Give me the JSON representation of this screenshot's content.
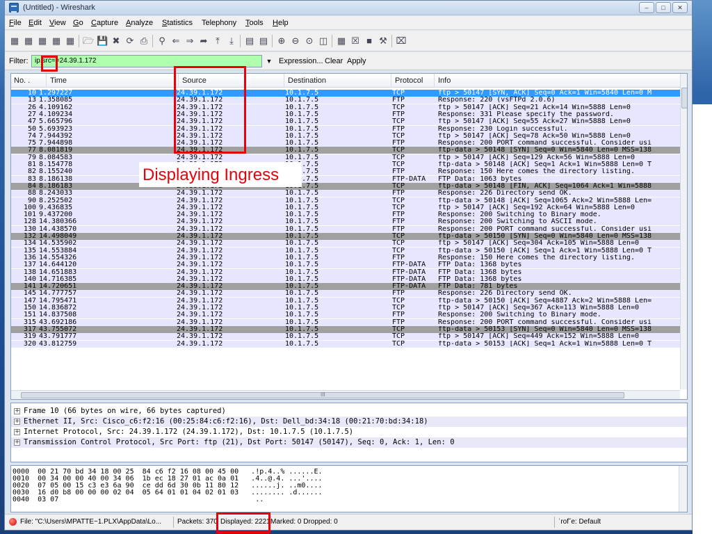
{
  "window": {
    "title": "(Untitled) - Wireshark"
  },
  "menu": [
    {
      "label": "File",
      "u": "F",
      "rest": "ile"
    },
    {
      "label": "Edit",
      "u": "E",
      "rest": "dit"
    },
    {
      "label": "View",
      "u": "V",
      "rest": "iew"
    },
    {
      "label": "Go",
      "u": "G",
      "rest": "o"
    },
    {
      "label": "Capture",
      "u": "C",
      "rest": "apture"
    },
    {
      "label": "Analyze",
      "u": "A",
      "rest": "nalyze"
    },
    {
      "label": "Statistics",
      "u": "S",
      "rest": "tatistics"
    },
    {
      "label": "Telephony",
      "u": "",
      "rest": "Telephony"
    },
    {
      "label": "Tools",
      "u": "T",
      "rest": "ools"
    },
    {
      "label": "Help",
      "u": "H",
      "rest": "elp"
    }
  ],
  "filter": {
    "label": "Filter:",
    "value": "ip.src==24.39.1.172",
    "expression": "Expression...",
    "clear": "Clear",
    "apply": "Apply"
  },
  "columns": [
    "No. .",
    "Time",
    "Source",
    "Destination",
    "Protocol",
    "Info"
  ],
  "packets": [
    {
      "no": "10",
      "time": "1.297227",
      "src": "24.39.1.172",
      "dst": "10.1.7.5",
      "proto": "TCP",
      "info": "ftp > 50147 [SYN, ACK] Seq=0 Ack=1 Win=5840 Len=0 M",
      "style": "sel"
    },
    {
      "no": "13",
      "time": "1.358085",
      "src": "24.39.1.172",
      "dst": "10.1.7.5",
      "proto": "FTP",
      "info": "Response: 220 (vsFTPd 2.0.6)",
      "style": "ftp"
    },
    {
      "no": "26",
      "time": "4.109162",
      "src": "24.39.1.172",
      "dst": "10.1.7.5",
      "proto": "TCP",
      "info": "ftp > 50147 [ACK] Seq=21 Ack=14 Win=5888 Len=0",
      "style": "tcp"
    },
    {
      "no": "27",
      "time": "4.109234",
      "src": "24.39.1.172",
      "dst": "10.1.7.5",
      "proto": "FTP",
      "info": "Response: 331 Please specify the password.",
      "style": "ftp"
    },
    {
      "no": "47",
      "time": "5.665796",
      "src": "24.39.1.172",
      "dst": "10.1.7.5",
      "proto": "TCP",
      "info": "ftp > 50147 [ACK] Seq=55 Ack=27 Win=5888 Len=0",
      "style": "tcp"
    },
    {
      "no": "50",
      "time": "5.693923",
      "src": "24.39.1.172",
      "dst": "10.1.7.5",
      "proto": "FTP",
      "info": "Response: 230 Login successful.",
      "style": "ftp"
    },
    {
      "no": "74",
      "time": "7.944392",
      "src": "24.39.1.172",
      "dst": "10.1.7.5",
      "proto": "TCP",
      "info": "ftp > 50147 [ACK] Seq=78 Ack=50 Win=5888 Len=0",
      "style": "tcp"
    },
    {
      "no": "75",
      "time": "7.944898",
      "src": "24.39.1.172",
      "dst": "10.1.7.5",
      "proto": "FTP",
      "info": "Response: 200 PORT command successful. Consider usi",
      "style": "ftp"
    },
    {
      "no": "77",
      "time": "8.081819",
      "src": "24.39.1.172",
      "dst": "10.1.7.5",
      "proto": "TCP",
      "info": "ftp-data > 50148 [SYN] Seq=0 Win=5840 Len=0 MSS=138",
      "style": "syn"
    },
    {
      "no": "79",
      "time": "8.084583",
      "src": "24.39.1.172",
      "dst": "10.1.7.5",
      "proto": "TCP",
      "info": "ftp > 50147 [ACK] Seq=129 Ack=56 Win=5888 Len=0",
      "style": "tcp"
    },
    {
      "no": "81",
      "time": "8.154778",
      "src": "24.39.1.172",
      "dst": "10.1.7.5",
      "proto": "TCP",
      "info": "ftp-data > 50148 [ACK] Seq=1 Ack=1 Win=5888 Len=0 T",
      "style": "tcp"
    },
    {
      "no": "82",
      "time": "8.155240",
      "src": "24.39.1.172",
      "dst": "10.1.7.5",
      "proto": "FTP",
      "info": "Response: 150 Here comes the directory listing.",
      "style": "ftp"
    },
    {
      "no": "83",
      "time": "8.186138",
      "src": "24.39.1.172",
      "dst": "10.1.7.5",
      "proto": "FTP-DATA",
      "info": "FTP Data: 1063 bytes",
      "style": "ftpdata"
    },
    {
      "no": "84",
      "time": "8.186183",
      "src": "24.39.1.172",
      "dst": "10.1.7.5",
      "proto": "TCP",
      "info": "ftp-data > 50148 [FIN, ACK] Seq=1064 Ack=1 Win=5888",
      "style": "syn"
    },
    {
      "no": "88",
      "time": "8.243033",
      "src": "24.39.1.172",
      "dst": "10.1.7.5",
      "proto": "FTP",
      "info": "Response: 226 Directory send OK.",
      "style": "ftp"
    },
    {
      "no": "90",
      "time": "8.252502",
      "src": "24.39.1.172",
      "dst": "10.1.7.5",
      "proto": "TCP",
      "info": "ftp-data > 50148 [ACK] Seq=1065 Ack=2 Win=5888 Len=",
      "style": "tcp"
    },
    {
      "no": "100",
      "time": "9.436835",
      "src": "24.39.1.172",
      "dst": "10.1.7.5",
      "proto": "TCP",
      "info": "ftp > 50147 [ACK] Seq=192 Ack=64 Win=5888 Len=0",
      "style": "tcp"
    },
    {
      "no": "101",
      "time": "9.437200",
      "src": "24.39.1.172",
      "dst": "10.1.7.5",
      "proto": "FTP",
      "info": "Response: 200 Switching to Binary mode.",
      "style": "ftp"
    },
    {
      "no": "128",
      "time": "14.380366",
      "src": "24.39.1.172",
      "dst": "10.1.7.5",
      "proto": "FTP",
      "info": "Response: 200 Switching to ASCII mode.",
      "style": "ftp"
    },
    {
      "no": "130",
      "time": "14.438570",
      "src": "24.39.1.172",
      "dst": "10.1.7.5",
      "proto": "FTP",
      "info": "Response: 200 PORT command successful. Consider usi",
      "style": "ftp"
    },
    {
      "no": "132",
      "time": "14.498049",
      "src": "24.39.1.172",
      "dst": "10.1.7.5",
      "proto": "TCP",
      "info": "ftp-data > 50150 [SYN] Seq=0 Win=5840 Len=0 MSS=138",
      "style": "syn"
    },
    {
      "no": "134",
      "time": "14.535902",
      "src": "24.39.1.172",
      "dst": "10.1.7.5",
      "proto": "TCP",
      "info": "ftp > 50147 [ACK] Seq=304 Ack=105 Win=5888 Len=0",
      "style": "tcp"
    },
    {
      "no": "135",
      "time": "14.553884",
      "src": "24.39.1.172",
      "dst": "10.1.7.5",
      "proto": "TCP",
      "info": "ftp-data > 50150 [ACK] Seq=1 Ack=1 Win=5888 Len=0 T",
      "style": "tcp"
    },
    {
      "no": "136",
      "time": "14.554326",
      "src": "24.39.1.172",
      "dst": "10.1.7.5",
      "proto": "FTP",
      "info": "Response: 150 Here comes the directory listing.",
      "style": "ftp"
    },
    {
      "no": "137",
      "time": "14.644120",
      "src": "24.39.1.172",
      "dst": "10.1.7.5",
      "proto": "FTP-DATA",
      "info": "FTP Data: 1368 bytes",
      "style": "ftpdata"
    },
    {
      "no": "138",
      "time": "14.651883",
      "src": "24.39.1.172",
      "dst": "10.1.7.5",
      "proto": "FTP-DATA",
      "info": "FTP Data: 1368 bytes",
      "style": "ftpdata"
    },
    {
      "no": "140",
      "time": "14.716385",
      "src": "24.39.1.172",
      "dst": "10.1.7.5",
      "proto": "FTP-DATA",
      "info": "FTP Data: 1368 bytes",
      "style": "ftpdata"
    },
    {
      "no": "141",
      "time": "14.720651",
      "src": "24.39.1.172",
      "dst": "10.1.7.5",
      "proto": "FTP-DATA",
      "info": "FTP Data: 781 bytes",
      "style": "syn"
    },
    {
      "no": "145",
      "time": "14.777757",
      "src": "24.39.1.172",
      "dst": "10.1.7.5",
      "proto": "FTP",
      "info": "Response: 226 Directory send OK.",
      "style": "ftp"
    },
    {
      "no": "147",
      "time": "14.795471",
      "src": "24.39.1.172",
      "dst": "10.1.7.5",
      "proto": "TCP",
      "info": "ftp-data > 50150 [ACK] Seq=4887 Ack=2 Win=5888 Len=",
      "style": "tcp"
    },
    {
      "no": "150",
      "time": "14.836872",
      "src": "24.39.1.172",
      "dst": "10.1.7.5",
      "proto": "TCP",
      "info": "ftp > 50147 [ACK] Seq=367 Ack=113 Win=5888 Len=0",
      "style": "tcp"
    },
    {
      "no": "151",
      "time": "14.837508",
      "src": "24.39.1.172",
      "dst": "10.1.7.5",
      "proto": "FTP",
      "info": "Response: 200 Switching to Binary mode.",
      "style": "ftp"
    },
    {
      "no": "315",
      "time": "43.692186",
      "src": "24.39.1.172",
      "dst": "10.1.7.5",
      "proto": "FTP",
      "info": "Response: 200 PORT command successful. Consider usi",
      "style": "ftp"
    },
    {
      "no": "317",
      "time": "43.755072",
      "src": "24.39.1.172",
      "dst": "10.1.7.5",
      "proto": "TCP",
      "info": "ftp-data > 50153 [SYN] Seq=0 Win=5840 Len=0 MSS=138",
      "style": "syn"
    },
    {
      "no": "319",
      "time": "43.791777",
      "src": "24.39.1.172",
      "dst": "10.1.7.5",
      "proto": "TCP",
      "info": "ftp > 50147 [ACK] Seq=449 Ack=152 Win=5888 Len=0",
      "style": "tcp"
    },
    {
      "no": "320",
      "time": "43.812759",
      "src": "24.39.1.172",
      "dst": "10.1.7.5",
      "proto": "TCP",
      "info": "ftp-data > 50153 [ACK] Seq=1 Ack=1 Win=5888 Len=0 T",
      "style": "tcp"
    }
  ],
  "hscroll_marker": "III",
  "details": [
    "Frame 10 (66 bytes on wire, 66 bytes captured)",
    "Ethernet II, Src: Cisco_c6:f2:16 (00:25:84:c6:f2:16), Dst: Dell_bd:34:18 (00:21:70:bd:34:18)",
    "Internet Protocol, Src: 24.39.1.172 (24.39.1.172), Dst: 10.1.7.5 (10.1.7.5)",
    "Transmission Control Protocol, Src Port: ftp (21), Dst Port: 50147 (50147), Seq: 0, Ack: 1, Len: 0"
  ],
  "hex": [
    "0000  00 21 70 bd 34 18 00 25  84 c6 f2 16 08 00 45 00   .!p.4..% ......E.",
    "0010  00 34 00 00 40 00 34 06  1b ec 18 27 01 ac 0a 01   .4..@.4. ...'....",
    "0020  07 05 00 15 c3 e3 6a 90  ce dd 6d 30 0b 11 80 12   ......j. ..m0....",
    "0030  16 d0 b8 00 00 00 02 04  05 64 01 01 04 02 01 03   ........ .d......",
    "0040  03 07                                               .."
  ],
  "status": {
    "file": "File: \"C:\\Users\\MPATTE~1.PLX\\AppData\\Lo...",
    "packets": "Packets: 370",
    "displayed": "Displayed: 2221",
    "marked": "Marked: 0 Dropped: 0",
    "profile": "ʾrofˇe: Default"
  },
  "annotation": {
    "text": "Displaying Ingress",
    "color": "#e8000b"
  }
}
